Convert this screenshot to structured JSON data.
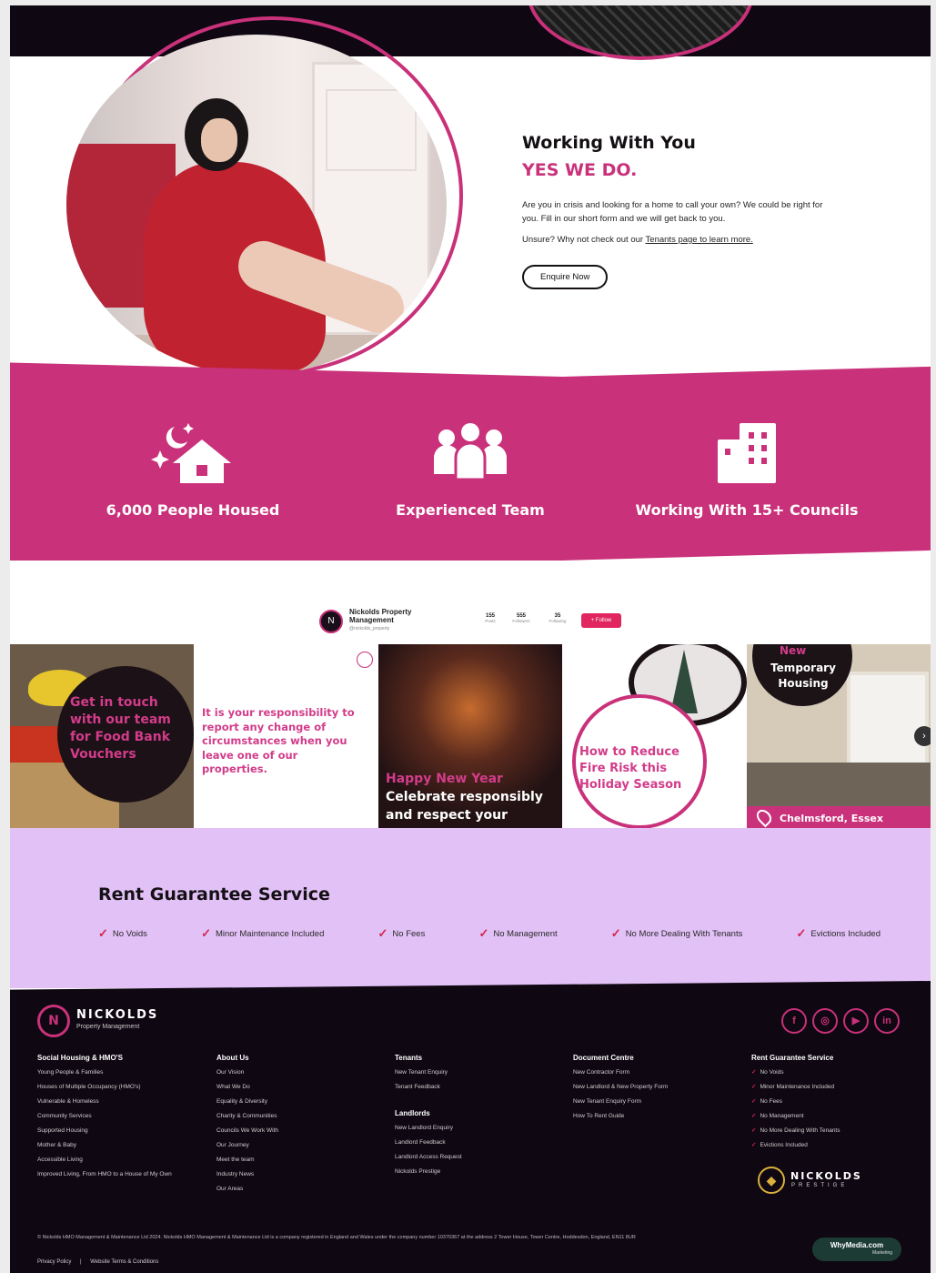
{
  "hero": {
    "title": "Working With You",
    "subtitle": "YES WE DO.",
    "body": "Are you in crisis and looking for a home to call your own? We could be right for you. Fill in our short form and we will get back to you.",
    "unsure_prefix": "Unsure? Why not check out our ",
    "unsure_link": "Tenants page to learn more.",
    "button": "Enquire Now"
  },
  "stats": [
    {
      "label": "6,000 People Housed",
      "icon": "house-moon-icon"
    },
    {
      "label": "Experienced Team",
      "icon": "team-icon"
    },
    {
      "label": "Working With 15+ Councils",
      "icon": "building-icon"
    }
  ],
  "instagram": {
    "name": "Nickolds Property Management",
    "handle": "@nickolds_property",
    "counts": [
      {
        "value": "155",
        "label": "Posts"
      },
      {
        "value": "555",
        "label": "Followers"
      },
      {
        "value": "35",
        "label": "Following"
      }
    ],
    "follow": "+ Follow",
    "tiles": {
      "t1": "Get in touch with our team for Food Bank Vouchers",
      "t2": "It is your responsibility to report any change of circumstances when you leave one of our properties.",
      "t3_title": "Happy New Year",
      "t3_body": "Celebrate responsibly and respect your",
      "t4": "How to Reduce Fire Risk this Holiday Season",
      "t5_new": "New",
      "t5_title": "Temporary Housing",
      "t5_location": "Chelmsford, Essex"
    }
  },
  "rent": {
    "title": "Rent Guarantee Service",
    "items": [
      "No Voids",
      "Minor Maintenance Included",
      "No Fees",
      "No Management",
      "No More Dealing With Tenants",
      "Evictions Included"
    ]
  },
  "footer": {
    "brand": "NICKOLDS",
    "brand_sub": "Property Management",
    "socials": [
      "f",
      "◎",
      "▶",
      "in"
    ],
    "columns": [
      {
        "heading": "Social Housing & HMO'S",
        "items": [
          "Young People & Families",
          "Houses of Multiple Occupancy (HMO's)",
          "Vulnerable & Homeless",
          "Community Services",
          "Supported Housing",
          "Mother & Baby",
          "Accessible Living",
          "Improved Living, From HMO to a House of My Own"
        ]
      },
      {
        "heading": "About Us",
        "items": [
          "Our Vision",
          "What We Do",
          "Equality & Diversity",
          "Charity & Communities",
          "Councils We Work With",
          "Our Journey",
          "Meet the team",
          "Industry News",
          "Our Areas"
        ]
      },
      {
        "heading": "Tenants",
        "items": [
          "New Tenant Enquiry",
          "Tenant Feedback"
        ],
        "heading2": "Landlords",
        "items2": [
          "New Landlord Enquiry",
          "Landlord Feedback",
          "Landlord Access Request",
          "Nickolds Prestige"
        ]
      },
      {
        "heading": "Document Centre",
        "items": [
          "New Contractor Form",
          "New Landlord & New Property Form",
          "New Tenant Enquiry Form",
          "How To Rent Guide"
        ]
      },
      {
        "heading": "Rent Guarantee Service",
        "items": [
          "No Voids",
          "Minor Maintenance Included",
          "No Fees",
          "No Management",
          "No More Dealing With Tenants",
          "Evictions Included"
        ]
      }
    ],
    "prestige_name": "NICKOLDS",
    "prestige_sub": "PRESTIGE",
    "legal": "© Nickolds HMO Management & Maintenance Ltd 2024. Nickolds HMO Management & Maintenance Ltd is a company registered in England and Wales under the company number 10370367 at the address 2 Tower House, Tower Centre, Hoddesdon, England, EN11 8UR",
    "links": [
      "Privacy Policy",
      "|",
      "Website Terms & Conditions"
    ],
    "badge_brand": "WhyMedia.com",
    "badge_sub": "Marketing"
  }
}
